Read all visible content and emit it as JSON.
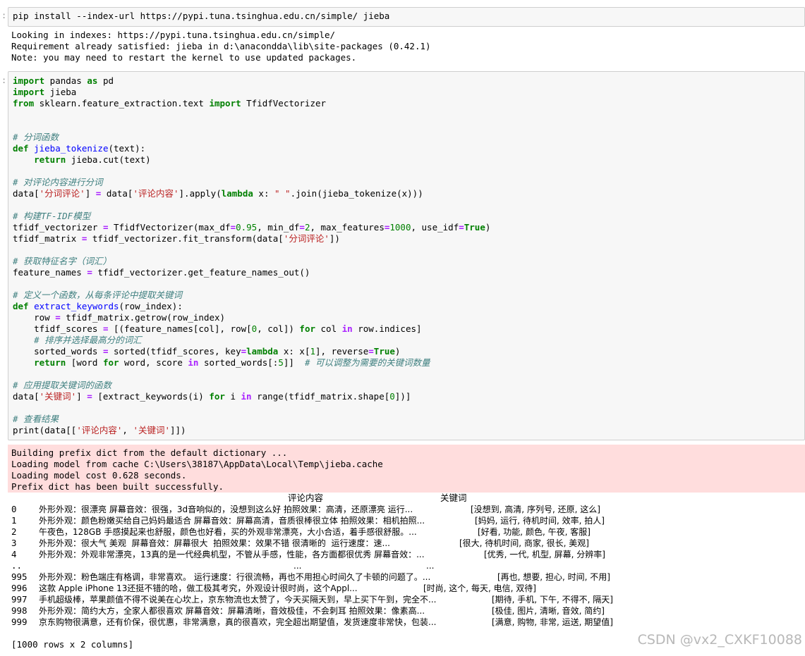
{
  "cell1": {
    "marker": ":",
    "code": "pip install --index-url https://pypi.tuna.tsinghua.edu.cn/simple/ jieba",
    "output": [
      "Looking in indexes: https://pypi.tuna.tsinghua.edu.cn/simple/",
      "Requirement already satisfied: jieba in d:\\anacondda\\lib\\site-packages (0.42.1)",
      "Note: you may need to restart the kernel to use updated packages."
    ]
  },
  "cell2": {
    "marker": ":",
    "comments": {
      "c1": "# 分词函数",
      "c2": "# 对评论内容进行分词",
      "c3": "# 构建TF-IDF模型",
      "c4": "# 获取特征名字（词汇）",
      "c5": "# 定义一个函数，从每条评论中提取关键词",
      "c6": "# 排序并选择最高分的词汇",
      "c7": "# 可以调整为需要的关键词数量",
      "c8": "# 应用提取关键词的函数",
      "c9": "# 查看结果"
    },
    "strings": {
      "col_seg": "'分词评论'",
      "col_content": "'评论内容'",
      "space": "\" \"",
      "col_kw": "'关键词'"
    },
    "stderr": [
      "Building prefix dict from the default dictionary ...",
      "Loading model from cache C:\\Users\\38187\\AppData\\Local\\Temp\\jieba.cache",
      "Loading model cost 0.628 seconds.",
      "Prefix dict has been built successfully."
    ],
    "df_header": {
      "col1": "评论内容",
      "col2": "关键词"
    },
    "df_rows": [
      {
        "idx": "0",
        "content": "外形外观：很漂亮 屏幕音效：很强，3d音响似的，没想到这么好 拍照效果：高清，还原漂亮 运行...",
        "kw": "[没想到, 高清, 序列号, 还原, 这么]"
      },
      {
        "idx": "1",
        "content": "外形外观：颜色粉嫩买给自己妈妈最适合 屏幕音效：屏幕高清，音质很棒很立体 拍照效果：相机拍照...",
        "kw": "[妈妈, 运行, 待机时间, 效率, 拍人]"
      },
      {
        "idx": "2",
        "content": "午夜色，128GB 手感摸起来也舒服，颜色也好看，买的外观非常漂亮，大小合适，着手感很舒服。...",
        "kw": "[好看, 功能, 颜色, 午夜, 客服]"
      },
      {
        "idx": "3",
        "content": "外形外观：很大气 美观  屏幕音效：屏幕很大  拍照效果：效果不错 很清晰的  运行速度：速...",
        "kw": "[很大, 待机时间, 商家, 很长, 美观]"
      },
      {
        "idx": "4",
        "content": "外形外观：外观非常漂亮，13真的是一代经典机型，不管从手感，性能，各方面都很优秀 屏幕音效：...",
        "kw": "[优秀, 一代, 机型, 屏幕, 分辨率]"
      },
      {
        "idx": "..",
        "content": "...",
        "kw": "..."
      },
      {
        "idx": "995",
        "content": "外形外观：粉色端庄有格调，非常喜欢。 运行速度：行很流畅，再也不用担心时间久了卡顿的问题了。...",
        "kw": "[再也, 想要, 担心, 时间, 不用]"
      },
      {
        "idx": "996",
        "content": "这款 Apple iPhone 13还挺不错的哈，做工极其考究，外观设计很时尚，这个Appl...",
        "kw": "[时尚, 这个, 每天, 电信, 双待]"
      },
      {
        "idx": "997",
        "content": "手机超级棒，苹果颜值不得不说美在心坎上，京东物流也太赞了，今天买隔天到，早上买下午到，完全不...",
        "kw": "[期待, 手机, 下午, 不得不, 隔天]"
      },
      {
        "idx": "998",
        "content": "外形外观：简约大方，全家人都很喜欢 屏幕音效：屏幕清晰，音效极佳，不会刺耳 拍照效果：像素高...",
        "kw": "[极佳, 图片, 清晰, 音效, 简约]"
      },
      {
        "idx": "999",
        "content": "京东购物很满意，还有价保，很优惠，非常满意，真的很喜欢，完全超出期望值，发货速度非常快，包装...",
        "kw": "[满意, 购物, 非常, 运送, 期望值]"
      }
    ],
    "df_shape": "[1000 rows x 2 columns]"
  },
  "watermark": "CSDN @vx2_CXKF10088"
}
